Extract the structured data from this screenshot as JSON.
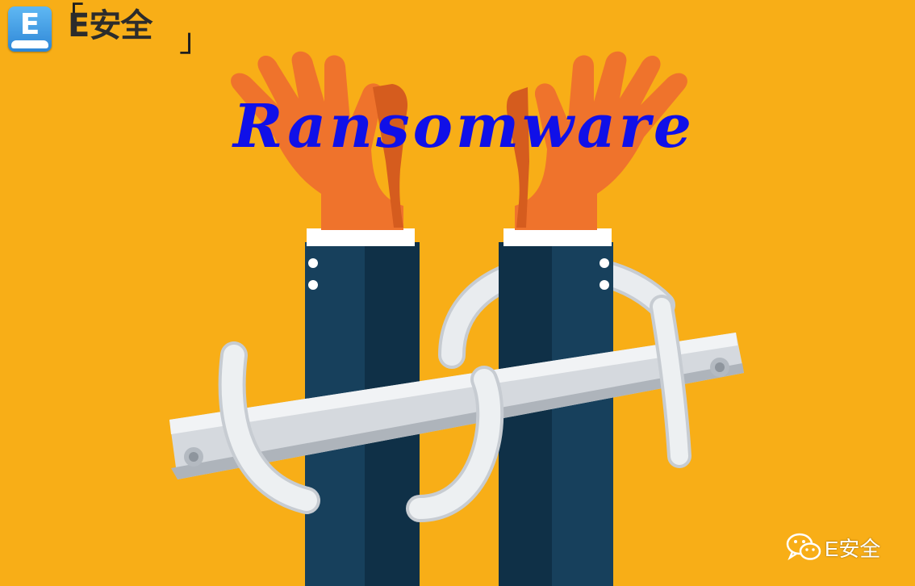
{
  "brand": {
    "logo_letter": "E",
    "logo_text": "E安全",
    "bracket_open": "「",
    "bracket_close": "」"
  },
  "headline": "Ransomware",
  "watermark": {
    "icon": "wechat-icon",
    "text": "E安全"
  },
  "colors": {
    "background": "#F8AE17",
    "hand": "#EF732C",
    "sleeve": "#17405C",
    "cuff": "#FFFFFF",
    "dollar_sign": "#E6EAEE",
    "headline": "#1010E8"
  }
}
